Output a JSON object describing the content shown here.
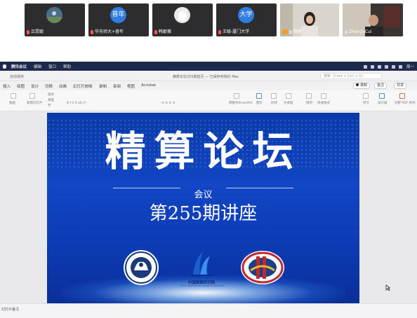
{
  "participants": [
    {
      "name": "吕昆聪",
      "avatar_type": "photo",
      "mic": "muted"
    },
    {
      "name": "华东师大+普年",
      "avatar_text": "普年",
      "avatar_color": "#2f7de1",
      "mic": "muted"
    },
    {
      "name": "韩郡薇",
      "avatar_type": "photo",
      "mic": "muted"
    },
    {
      "name": "王聪-厦门大学",
      "avatar_text": "大学",
      "avatar_color": "#2f7de1",
      "mic": "muted"
    },
    {
      "name": "微笑",
      "avatar_type": "video",
      "mic": "active"
    },
    {
      "name": "ZhenyuCui",
      "avatar_type": "video",
      "mic": "active"
    }
  ],
  "menubar": {
    "app_name": "腾讯会议",
    "items": [
      "编辑",
      "窗口",
      "帮助"
    ],
    "clock": "周一"
  },
  "window": {
    "quick_access": "自动保存",
    "document_title": "精算论坛255期首页 — 已保存到我的 Mac",
    "search_placeholder": "搜索（Cmd + Ctrl + U）"
  },
  "ribbon_tabs": [
    "插入",
    "绘图",
    "设计",
    "切换",
    "动画",
    "幻灯片放映",
    "录制",
    "审阅",
    "视图",
    "Acrobat"
  ],
  "ribbon_active_tab": "开始",
  "ribbon_right": {
    "record": "录制",
    "comments": "批注",
    "share": "共享"
  },
  "ribbon_groups": {
    "paste": "粘贴",
    "new_slide": "新建幻灯片",
    "layout": "版式",
    "reset": "重置",
    "section": "节",
    "convert_smartart": "转换为SmartArt",
    "picture": "图片",
    "shapes": "形状",
    "textbox": "文本框",
    "arrange": "排列",
    "quick_styles": "快速样式",
    "dictate": "听写",
    "designer": "设计器",
    "create_pdf": "创建 PDF 并共享链接"
  },
  "slide": {
    "title": "精算论坛",
    "meeting_label": "会议",
    "subtitle": "第255期讲座",
    "logos": [
      {
        "name": "university-seal-logo",
        "label": ""
      },
      {
        "name": "china-institute-actuarial-logo",
        "label": "中国精算研究院",
        "sub": "China Institute for Actuarial Science"
      },
      {
        "name": "research-institute-seal-logo",
        "label": ""
      }
    ],
    "colors": {
      "background": "#0d3bb4",
      "text": "#ffffff"
    }
  },
  "statusbar": {
    "text": "幻灯片备注"
  }
}
